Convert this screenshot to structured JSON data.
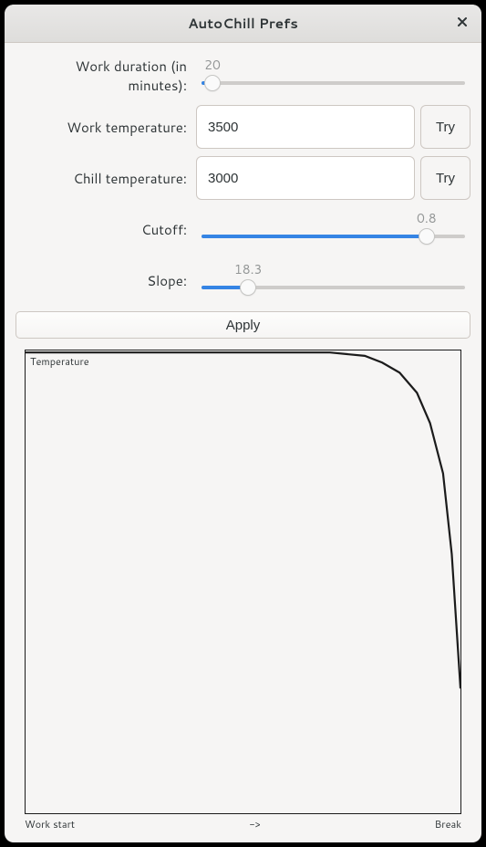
{
  "window": {
    "title": "AutoChill Prefs"
  },
  "labels": {
    "work_duration": "Work duration (in minutes):",
    "work_temp": "Work temperature:",
    "chill_temp": "Chill temperature:",
    "cutoff": "Cutoff:",
    "slope": "Slope:"
  },
  "values": {
    "work_duration": "20",
    "work_temp": "3500",
    "chill_temp": "3000",
    "cutoff": "0.8",
    "slope": "18.3"
  },
  "sliders": {
    "work_duration": {
      "pct": 4
    },
    "cutoff": {
      "pct": 82
    },
    "slope": {
      "pct": 17
    }
  },
  "buttons": {
    "try": "Try",
    "apply": "Apply"
  },
  "chart": {
    "ylabel": "Temperature",
    "xlabels": {
      "start": "Work start",
      "mid": "->",
      "end": "Break"
    }
  },
  "chart_data": {
    "type": "line",
    "title": "Temperature",
    "xlabel": "",
    "ylabel": "Temperature",
    "xlim": [
      0,
      1
    ],
    "ylim": [
      3000,
      3500
    ],
    "x_tick_labels": [
      "Work start",
      "->",
      "Break"
    ],
    "series": [
      {
        "name": "temperature",
        "x": [
          0.0,
          0.6,
          0.7,
          0.78,
          0.82,
          0.86,
          0.9,
          0.93,
          0.96,
          0.98,
          1.0
        ],
        "values": [
          3500,
          3500,
          3500,
          3495,
          3485,
          3470,
          3440,
          3395,
          3320,
          3200,
          3000
        ]
      }
    ]
  }
}
